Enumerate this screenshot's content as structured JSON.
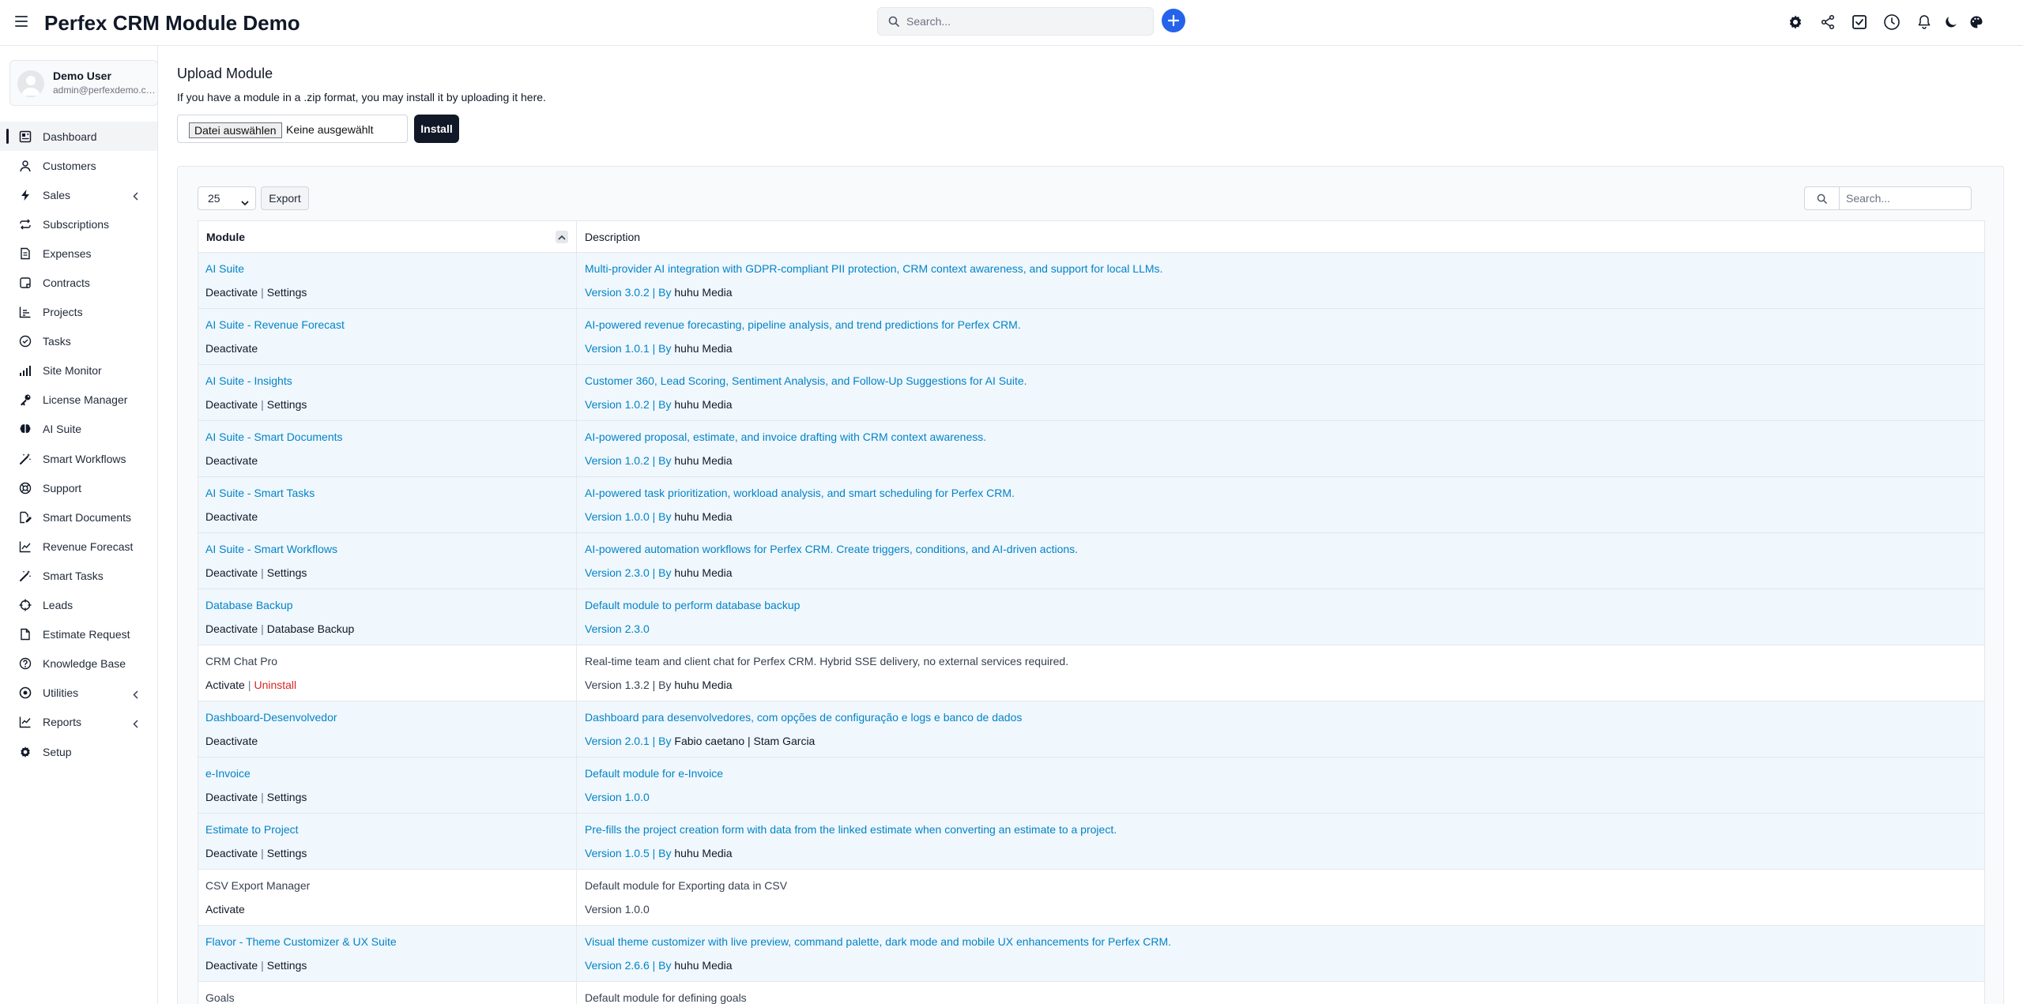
{
  "app": {
    "title": "Perfex CRM Module Demo"
  },
  "search": {
    "placeholder": "Search..."
  },
  "user": {
    "name": "Demo User",
    "email": "admin@perfexdemo.com"
  },
  "sidebar": {
    "items": [
      {
        "label": "Dashboard",
        "icon": "dashboard-icon",
        "active": true
      },
      {
        "label": "Customers",
        "icon": "user-icon"
      },
      {
        "label": "Sales",
        "icon": "bolt-icon",
        "has_children": true
      },
      {
        "label": "Subscriptions",
        "icon": "repeat-icon"
      },
      {
        "label": "Expenses",
        "icon": "receipt-icon"
      },
      {
        "label": "Contracts",
        "icon": "contract-icon"
      },
      {
        "label": "Projects",
        "icon": "chart-bar-icon"
      },
      {
        "label": "Tasks",
        "icon": "check-circle-icon"
      },
      {
        "label": "Site Monitor",
        "icon": "signal-bars-icon"
      },
      {
        "label": "License Manager",
        "icon": "key-icon"
      },
      {
        "label": "AI Suite",
        "icon": "brain-icon"
      },
      {
        "label": "Smart Workflows",
        "icon": "magic-wand-icon"
      },
      {
        "label": "Support",
        "icon": "lifebuoy-icon"
      },
      {
        "label": "Smart Documents",
        "icon": "file-edit-icon"
      },
      {
        "label": "Revenue Forecast",
        "icon": "line-chart-icon"
      },
      {
        "label": "Smart Tasks",
        "icon": "magic-wand-icon"
      },
      {
        "label": "Leads",
        "icon": "crosshair-icon"
      },
      {
        "label": "Estimate Request",
        "icon": "file-icon"
      },
      {
        "label": "Knowledge Base",
        "icon": "question-circle-icon"
      },
      {
        "label": "Utilities",
        "icon": "dot-circle-icon",
        "has_children": true
      },
      {
        "label": "Reports",
        "icon": "trend-chart-icon",
        "has_children": true
      },
      {
        "label": "Setup",
        "icon": "gear-icon"
      }
    ]
  },
  "upload": {
    "title": "Upload Module",
    "description": "If you have a module in a .zip format, you may install it by uploading it here.",
    "choose_file_label": "Datei auswählen",
    "no_file_label": "Keine ausgewählt",
    "install_label": "Install"
  },
  "table_controls": {
    "page_length": "25",
    "export_label": "Export",
    "search_placeholder": "Search..."
  },
  "table": {
    "headers": {
      "module": "Module",
      "description": "Description"
    },
    "rows": [
      {
        "name": "AI Suite",
        "active": true,
        "actions": [
          "Deactivate",
          "Settings"
        ],
        "description": "Multi-provider AI integration with GDPR-compliant PII protection, CRM context awareness, and support for local LLMs.",
        "version": "Version 3.0.2",
        "by": "By",
        "author": "huhu Media"
      },
      {
        "name": "AI Suite - Revenue Forecast",
        "active": true,
        "actions": [
          "Deactivate"
        ],
        "description": "AI-powered revenue forecasting, pipeline analysis, and trend predictions for Perfex CRM.",
        "version": "Version 1.0.1",
        "by": "By",
        "author": "huhu Media"
      },
      {
        "name": "AI Suite - Insights",
        "active": true,
        "actions": [
          "Deactivate",
          "Settings"
        ],
        "description": "Customer 360, Lead Scoring, Sentiment Analysis, and Follow-Up Suggestions for AI Suite.",
        "version": "Version 1.0.2",
        "by": "By",
        "author": "huhu Media"
      },
      {
        "name": "AI Suite - Smart Documents",
        "active": true,
        "actions": [
          "Deactivate"
        ],
        "description": "AI-powered proposal, estimate, and invoice drafting with CRM context awareness.",
        "version": "Version 1.0.2",
        "by": "By",
        "author": "huhu Media"
      },
      {
        "name": "AI Suite - Smart Tasks",
        "active": true,
        "actions": [
          "Deactivate"
        ],
        "description": "AI-powered task prioritization, workload analysis, and smart scheduling for Perfex CRM.",
        "version": "Version 1.0.0",
        "by": "By",
        "author": "huhu Media"
      },
      {
        "name": "AI Suite - Smart Workflows",
        "active": true,
        "actions": [
          "Deactivate",
          "Settings"
        ],
        "description": "AI-powered automation workflows for Perfex CRM. Create triggers, conditions, and AI-driven actions.",
        "version": "Version 2.3.0",
        "by": "By",
        "author": "huhu Media"
      },
      {
        "name": "Database Backup",
        "active": true,
        "actions": [
          "Deactivate",
          "Database Backup"
        ],
        "description": "Default module to perform database backup",
        "version": "Version 2.3.0",
        "by": "",
        "author": ""
      },
      {
        "name": "CRM Chat Pro",
        "active": false,
        "actions": [
          "Activate",
          "Uninstall"
        ],
        "description": "Real-time team and client chat for Perfex CRM. Hybrid SSE delivery, no external services required.",
        "version": "Version 1.3.2",
        "by": "By",
        "author": "huhu Media"
      },
      {
        "name": "Dashboard-Desenvolvedor",
        "active": true,
        "actions": [
          "Deactivate"
        ],
        "description": "Dashboard para desenvolvedores, com opções de configuração e logs e banco de dados",
        "version": "Version 2.0.1",
        "by": "By",
        "author": "Fabio caetano | Stam Garcia"
      },
      {
        "name": "e-Invoice",
        "active": true,
        "actions": [
          "Deactivate",
          "Settings"
        ],
        "description": "Default module for e-Invoice",
        "version": "Version 1.0.0",
        "by": "",
        "author": ""
      },
      {
        "name": "Estimate to Project",
        "active": true,
        "actions": [
          "Deactivate",
          "Settings"
        ],
        "description": "Pre-fills the project creation form with data from the linked estimate when converting an estimate to a project.",
        "version": "Version 1.0.5",
        "by": "By",
        "author": "huhu Media"
      },
      {
        "name": "CSV Export Manager",
        "active": false,
        "actions": [
          "Activate"
        ],
        "description": "Default module for Exporting data in CSV",
        "version": "Version 1.0.0",
        "by": "",
        "author": ""
      },
      {
        "name": "Flavor - Theme Customizer & UX Suite",
        "active": true,
        "actions": [
          "Deactivate",
          "Settings"
        ],
        "description": "Visual theme customizer with live preview, command palette, dark mode and mobile UX enhancements for Perfex CRM.",
        "version": "Version 2.6.6",
        "by": "By",
        "author": "huhu Media"
      },
      {
        "name": "Goals",
        "active": false,
        "actions": [],
        "description": "Default module for defining goals",
        "version": "",
        "by": "",
        "author": ""
      }
    ]
  },
  "colors": {
    "accent": "#2563eb",
    "link": "#0284c7",
    "danger": "#dc2626",
    "active_row": "#f0f7fd",
    "dark_button": "#111827"
  }
}
